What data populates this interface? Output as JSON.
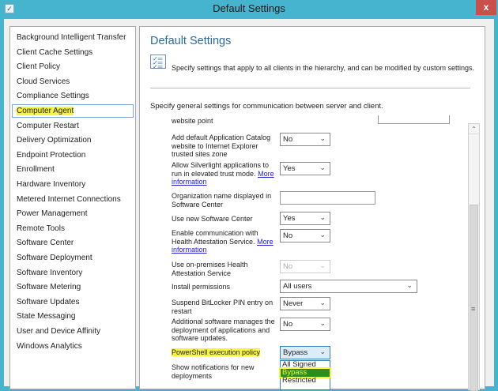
{
  "window": {
    "title": "Default Settings",
    "close": "x",
    "icon": "settings-window-icon"
  },
  "sidebar": {
    "items": [
      "Background Intelligent Transfer",
      "Client Cache Settings",
      "Client Policy",
      "Cloud Services",
      "Compliance Settings",
      "Computer Agent",
      "Computer Restart",
      "Delivery Optimization",
      "Endpoint Protection",
      "Enrollment",
      "Hardware Inventory",
      "Metered Internet Connections",
      "Power Management",
      "Remote Tools",
      "Software Center",
      "Software Deployment",
      "Software Inventory",
      "Software Metering",
      "Software Updates",
      "State Messaging",
      "User and Device Affinity",
      "Windows Analytics"
    ],
    "selected": "Computer Agent"
  },
  "main": {
    "title": "Default Settings",
    "description": "Specify settings that apply to all clients in the hierarchy, and can be modified by custom settings.",
    "section_description": "Specify general settings for communication between server and client.",
    "partial_label": "website point",
    "settings": [
      {
        "label": "Add default Application Catalog website to Internet Explorer trusted sites zone",
        "value": "No"
      },
      {
        "label": "Allow Silverlight applications to run in elevated trust mode.",
        "link": "More information",
        "value": "Yes"
      },
      {
        "label": "Organization name displayed in Software Center",
        "value": ""
      },
      {
        "label": "Use new Software Center",
        "value": "Yes"
      },
      {
        "label": "Enable communication with Health Attestation Service.",
        "link": "More information",
        "value": "No"
      },
      {
        "label": "Use on-premises Health Attestation Service",
        "value": "No"
      },
      {
        "label": "Install permissions",
        "value": "All users"
      },
      {
        "label": "Suspend BitLocker PIN entry on restart",
        "value": "Never"
      },
      {
        "label": "Additional software manages the deployment of applications and software updates.",
        "value": "No"
      },
      {
        "label": "PowerShell execution policy",
        "value": "Bypass"
      },
      {
        "label": "Show notifications for new deployments"
      }
    ],
    "dropdown_options": [
      "All Signed",
      "Bypass",
      "Restricted"
    ],
    "dropdown_selected": "Bypass"
  }
}
